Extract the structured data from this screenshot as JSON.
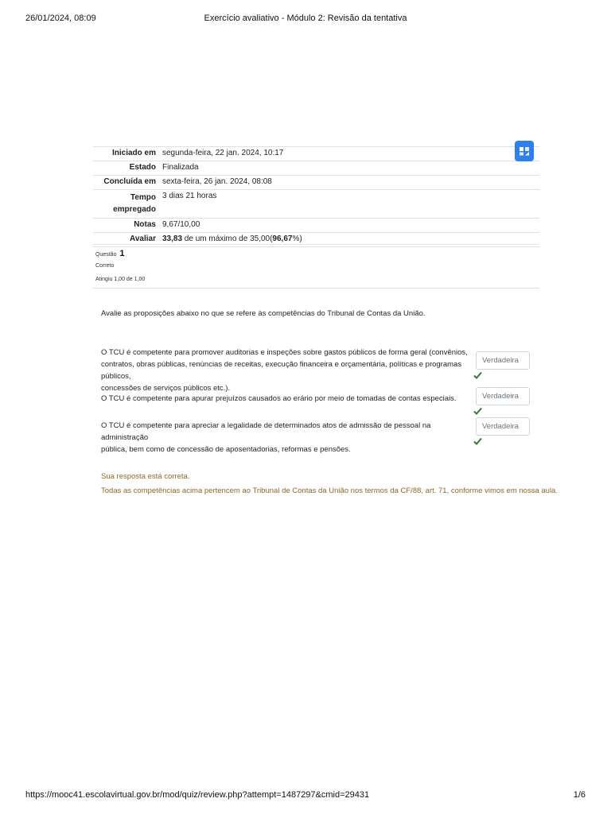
{
  "print_header": {
    "datetime": "26/01/2024, 08:09",
    "title": "Exercício avaliativo - Módulo 2: Revisão da tentativa"
  },
  "summary": {
    "rows": [
      {
        "label": "Iniciado em",
        "value": "segunda-feira, 22 jan. 2024, 10:17"
      },
      {
        "label": "Estado",
        "value": "Finalizada"
      },
      {
        "label": "Concluída em",
        "value": "sexta-feira, 26 jan. 2024, 08:08"
      },
      {
        "label_line1": "Tempo",
        "label_line2": "empregado",
        "value": "3 dias 21 horas"
      },
      {
        "label": "Notas",
        "value": "9,67/10,00"
      },
      {
        "label": "Avaliar",
        "score": "33,83",
        "middle": " de um máximo de 35,00(",
        "percent": "96,67",
        "suffix": "%)"
      }
    ]
  },
  "nav_icon": "quiz-navigation-icon",
  "question": {
    "label": "Questão",
    "number": "1",
    "state": "Correto",
    "grade": "Atingiu 1,00 de 1,00",
    "text": "Avalie as proposições abaixo no que se refere às competências do Tribunal de Contas da União.",
    "propositions": [
      {
        "lines": [
          "O TCU é competente para promover auditorias e inspeções sobre gastos públicos de forma geral (convênios,",
          "contratos, obras públicas, renúncias de receitas, execução financeira e orçamentária, políticas e programas públicos,",
          "concessões de serviços públicos etc.)."
        ],
        "answer": "Verdadeira"
      },
      {
        "lines": [
          "O TCU é competente para apurar prejuízos causados ao erário por meio de tomadas de contas especiais."
        ],
        "answer": "Verdadeira"
      },
      {
        "lines": [
          "O TCU é competente para apreciar a legalidade de determinados atos de admissão de pessoal na administração",
          "pública, bem como de concessão de aposentadorias, reformas e pensões."
        ],
        "answer": "Verdadeira"
      }
    ],
    "feedback_correct": "Sua resposta está correta.",
    "feedback_general": "Todas as competências acima pertencem ao Tribunal de Contas da União nos termos da CF/88, art. 71, conforme vimos em nossa aula."
  },
  "print_footer": {
    "url": "https://mooc41.escolavirtual.gov.br/mod/quiz/review.php?attempt=1487297&cmid=29431",
    "page": "1/6"
  },
  "colors": {
    "check": "#357a32",
    "feedback": "#8e662e",
    "nav_button": "#2f80ed"
  }
}
